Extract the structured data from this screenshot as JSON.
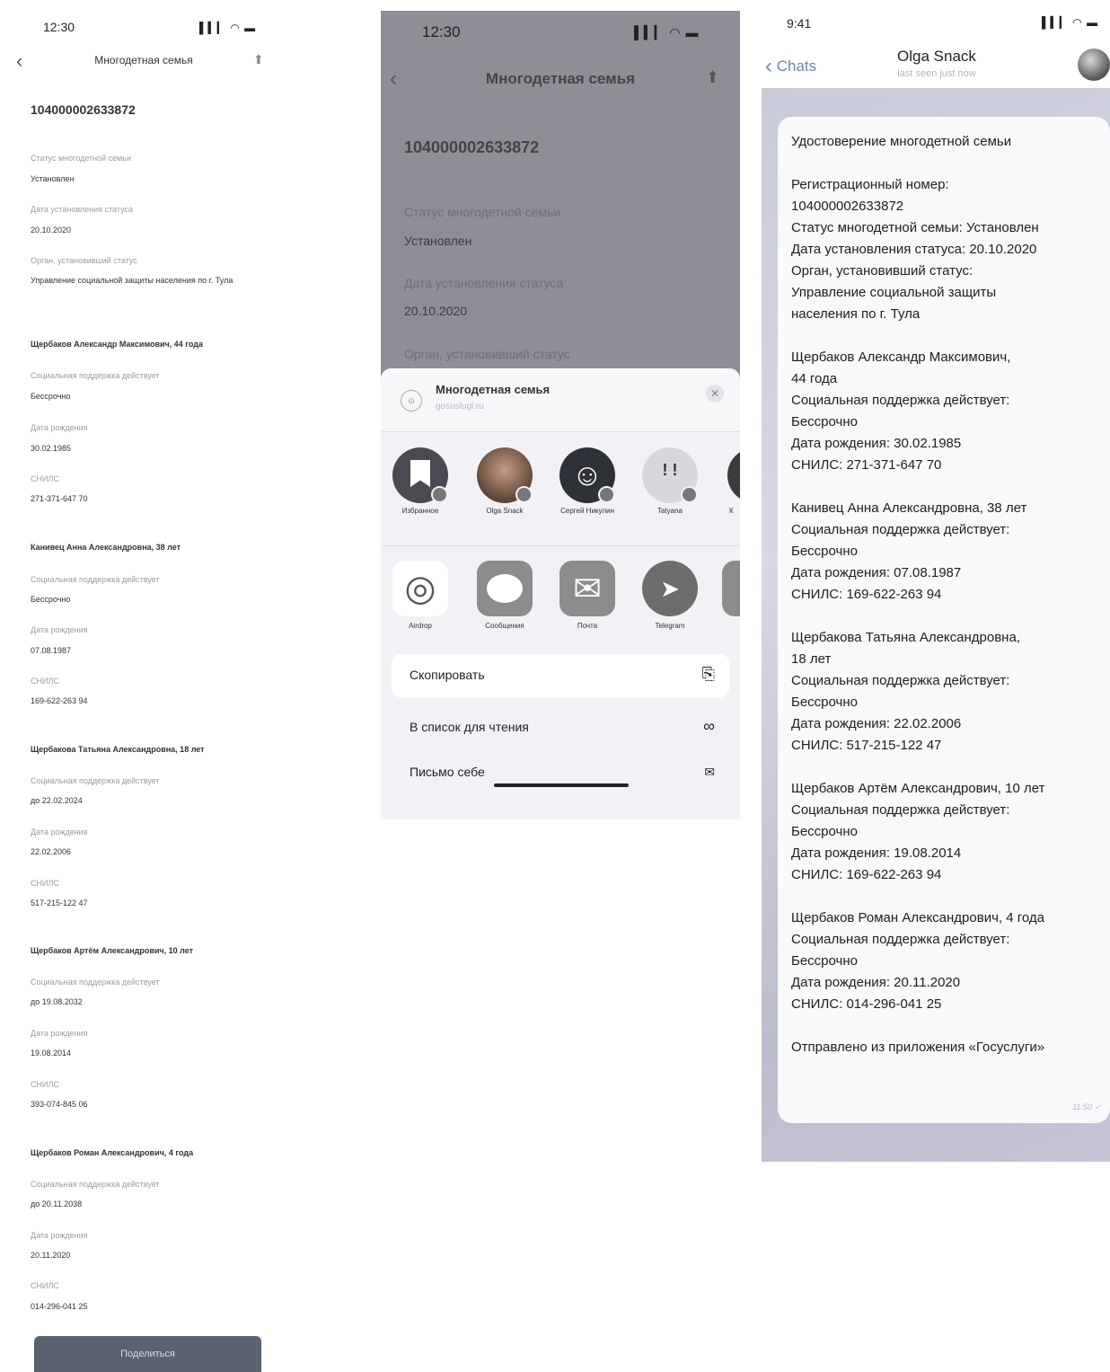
{
  "screen1": {
    "time": "12:30",
    "status_icons": "▌▍▎ ◠ ▬",
    "back_icon": "‹",
    "title": "Многодетная семья",
    "share_icon": "⬆",
    "reg_number": "104000002633872",
    "fields": [
      {
        "label": "Статус многодетной семьи",
        "value": "Установлен"
      },
      {
        "label": "Дата установления статуса",
        "value": "20.10.2020"
      },
      {
        "label": "Орган, установивший статус",
        "value": "Управление социальной защиты населения по г. Тула"
      }
    ],
    "members": [
      {
        "header": "Щербаков Александр Максимович, 44 года",
        "support_label": "Социальная поддержка действует",
        "support": "Бессрочно",
        "dob_label": "Дата рождения",
        "dob": "30.02.1985",
        "snils_label": "СНИЛС",
        "snils": "271-371-647 70"
      },
      {
        "header": "Канивец Анна Александровна, 38 лет",
        "support_label": "Социальная поддержка действует",
        "support": "Бессрочно",
        "dob_label": "Дата рождения",
        "dob": "07.08.1987",
        "snils_label": "СНИЛС",
        "snils": "169-622-263 94"
      },
      {
        "header": "Щербакова Татьяна Александровна, 18 лет",
        "support_label": "Социальная поддержка действует",
        "support": "до 22.02.2024",
        "dob_label": "Дата рождения",
        "dob": "22.02.2006",
        "snils_label": "СНИЛС",
        "snils": "517-215-122 47"
      },
      {
        "header": "Щербаков Артём Александрович, 10 лет",
        "support_label": "Социальная поддержка действует",
        "support": "до 19.08.2032",
        "dob_label": "Дата рождения",
        "dob": "19.08.2014",
        "snils_label": "СНИЛС",
        "snils": "393-074-845 06"
      },
      {
        "header": "Щербаков Роман Александрович, 4 года",
        "support_label": "Социальная поддержка действует",
        "support": "до 20.11.2038",
        "dob_label": "Дата рождения",
        "dob": "20.11.2020",
        "snils_label": "СНИЛС",
        "snils": "014-296-041 25"
      }
    ],
    "share_button": "Поделиться"
  },
  "screen2": {
    "time": "12:30",
    "status_icons": "▌▍▎ ◠ ▬",
    "back_icon": "‹",
    "title": "Многодетная семья",
    "share_icon": "⬆",
    "reg_number": "104000002633872",
    "status_label": "Статус многодетной семьи",
    "status_value": "Установлен",
    "date_label": "Дата установления статуса",
    "date_value": "20.10.2020",
    "org_label": "Орган, установивший статус",
    "sheet": {
      "title": "Многодетная семья",
      "subtitle": "gosuslugi.ru",
      "close_icon": "✕",
      "contacts": [
        {
          "name": "Избранное",
          "color": "#4a4a52",
          "glyph": "▮"
        },
        {
          "name": "Olga Snack",
          "color": "#8a6c5c",
          "glyph": ""
        },
        {
          "name": "Сергей Никулин",
          "color": "#2f3138",
          "glyph": "☺"
        },
        {
          "name": "Tatyana",
          "color": "#d7d7dd",
          "glyph": "! !"
        },
        {
          "name": "К",
          "color": "#3b3b3b",
          "glyph": ""
        }
      ],
      "apps": [
        {
          "name": "Airdrop",
          "bg": "#ffffff",
          "glyph": "◎",
          "color": "#555"
        },
        {
          "name": "Сообщения",
          "bg": "#8c8c8c",
          "glyph": "●",
          "color": "#fff"
        },
        {
          "name": "Почта",
          "bg": "#8c8c8c",
          "glyph": "✉",
          "color": "#fff"
        },
        {
          "name": "Telegram",
          "bg": "#6d6d6d",
          "glyph": "➤",
          "color": "#fff"
        },
        {
          "name": "",
          "bg": "#8c8c8c",
          "glyph": "",
          "color": "#fff"
        }
      ],
      "actions": [
        {
          "label": "Скопировать",
          "icon": "⎘"
        },
        {
          "label": "В список для чтения",
          "icon": "∞"
        },
        {
          "label": "Письмо себе",
          "icon": "✉"
        }
      ]
    }
  },
  "screen3": {
    "time": "9:41",
    "status_icons": "▌▍▎ ◠ ▬",
    "back_icon": "‹",
    "back_label": "Chats",
    "contact_name": "Olga Snack",
    "last_seen": "last seen just now",
    "message": "Удостоверение многодетной семьи\n\nРегистрационный номер:\n104000002633872\nСтатус многодетной семьи: Установлен\nДата установления статуса: 20.10.2020\nОрган, установивший статус:\nУправление социальной защиты\nнаселения по г. Тула\n\nЩербаков Александр Максимович,\n44 года\nСоциальная поддержка действует:\nБессрочно\nДата рождения: 30.02.1985\nСНИЛС: 271-371-647 70\n\nКанивец Анна Александровна, 38 лет\nСоциальная поддержка действует:\nБессрочно\nДата рождения: 07.08.1987\nСНИЛС: 169-622-263 94\n\nЩербакова Татьяна Александровна,\n18 лет\nСоциальная поддержка действует:\nБессрочно\nДата рождения: 22.02.2006\nСНИЛС: 517-215-122 47\n\nЩербаков Артём Александрович, 10 лет\nСоциальная поддержка действует:\nБессрочно\nДата рождения: 19.08.2014\nСНИЛС: 169-622-263 94\n\nЩербаков Роман Александрович, 4 года\nСоциальная поддержка действует:\nБессрочно\nДата рождения: 20.11.2020\nСНИЛС: 014-296-041 25\n\nОтправлено из приложения «Госуслуги»",
    "message_time": "11:50 ✓"
  }
}
